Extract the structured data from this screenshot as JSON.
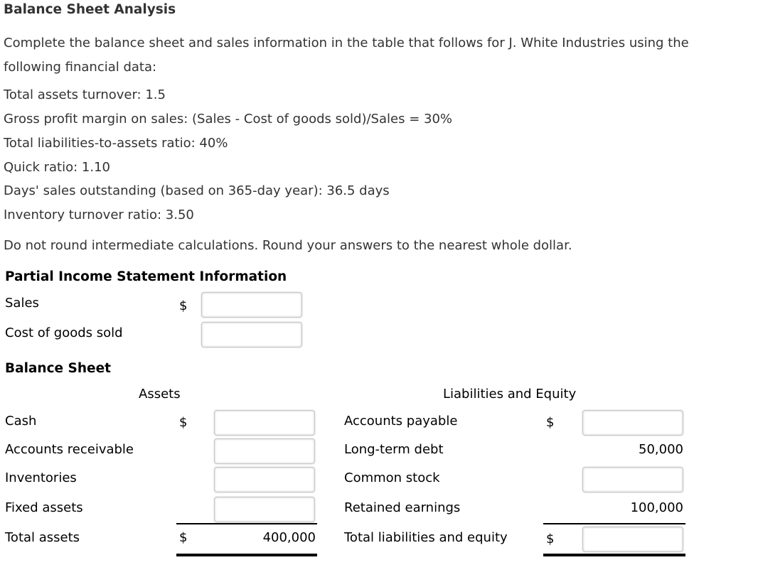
{
  "title": "Balance Sheet Analysis",
  "intro": "Complete the balance sheet and sales information in the table that follows for J. White Industries using the following financial data:",
  "given_data": [
    "Total assets turnover: 1.5",
    "Gross profit margin on sales: (Sales - Cost of goods sold)/Sales = 30%",
    "Total liabilities-to-assets ratio: 40%",
    "Quick ratio: 1.10",
    "Days' sales outstanding (based on 365-day year): 36.5 days",
    "Inventory turnover ratio: 3.50"
  ],
  "instruction": "Do not round intermediate calculations. Round your answers to the nearest whole dollar.",
  "income_statement": {
    "heading": "Partial Income Statement Information",
    "currency_symbol": "$",
    "rows": [
      {
        "label": "Sales",
        "value": ""
      },
      {
        "label": "Cost of goods sold",
        "value": ""
      }
    ]
  },
  "balance_sheet": {
    "heading": "Balance Sheet",
    "currency_symbol": "$",
    "assets": {
      "heading": "Assets",
      "rows": [
        {
          "label": "Cash",
          "value": ""
        },
        {
          "label": "Accounts receivable",
          "value": ""
        },
        {
          "label": "Inventories",
          "value": ""
        },
        {
          "label": "Fixed assets",
          "value": ""
        }
      ],
      "total": {
        "label": "Total assets",
        "value": "400,000"
      }
    },
    "liabilities_equity": {
      "heading": "Liabilities and Equity",
      "rows": [
        {
          "label": "Accounts payable",
          "value": ""
        },
        {
          "label": "Long-term debt",
          "value": "50,000"
        },
        {
          "label": "Common stock",
          "value": ""
        },
        {
          "label": "Retained earnings",
          "value": "100,000"
        }
      ],
      "total": {
        "label": "Total liabilities and equity",
        "value": ""
      }
    }
  }
}
